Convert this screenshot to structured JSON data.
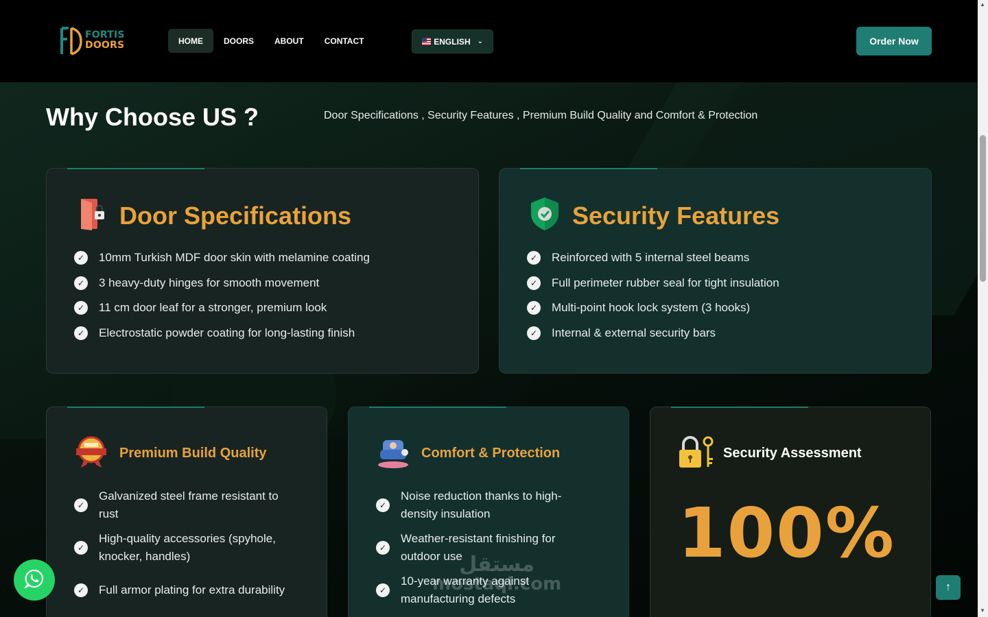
{
  "brand": {
    "line1": "FORTIS",
    "line2": "DOORS",
    "mark": "FD"
  },
  "nav": {
    "items": [
      {
        "label": "HOME",
        "active": true
      },
      {
        "label": "DOORS"
      },
      {
        "label": "ABOUT"
      },
      {
        "label": "CONTACT"
      }
    ],
    "language": "ENGLISH",
    "language_icon": "us-flag-icon"
  },
  "order_button": "Order Now",
  "section": {
    "title": "Why Choose US ?",
    "subtitle": "Door Specifications , Security Features , Premium Build Quality and Comfort & Protection"
  },
  "cards": {
    "door_specs": {
      "title": "Door Specifications",
      "icon": "door-lock-icon",
      "items": [
        "10mm Turkish MDF door skin with melamine coating",
        "3 heavy-duty hinges for smooth movement",
        "11 cm door leaf for a stronger, premium look",
        "Electrostatic powder coating for long-lasting finish"
      ]
    },
    "security": {
      "title": "Security Features",
      "icon": "shield-check-icon",
      "items": [
        "Reinforced with 5 internal steel beams",
        "Full perimeter rubber seal for tight insulation",
        "Multi-point hook lock system (3 hooks)",
        "Internal & external security bars"
      ]
    },
    "build_quality": {
      "title": "Premium Build Quality",
      "icon": "high-quality-badge-icon",
      "items": [
        "Galvanized steel frame resistant to rust",
        "High-quality accessories (spyhole, knocker, handles)",
        "Full armor plating for extra durability"
      ]
    },
    "comfort": {
      "title": "Comfort & Protection",
      "icon": "armchair-icon",
      "items": [
        "Noise reduction thanks to high-density insulation",
        "Weather-resistant finishing for outdoor use",
        "10-year warranty against manufacturing defects"
      ]
    },
    "assessment": {
      "title": "Security Assessment",
      "icon": "padlock-key-icon",
      "value": "100%"
    }
  },
  "watermark": {
    "line1": "مستقل",
    "line2": "mostaql.com"
  },
  "colors": {
    "accent": "#e9a23b",
    "teal": "#1f7d73",
    "whatsapp": "#25d366"
  }
}
